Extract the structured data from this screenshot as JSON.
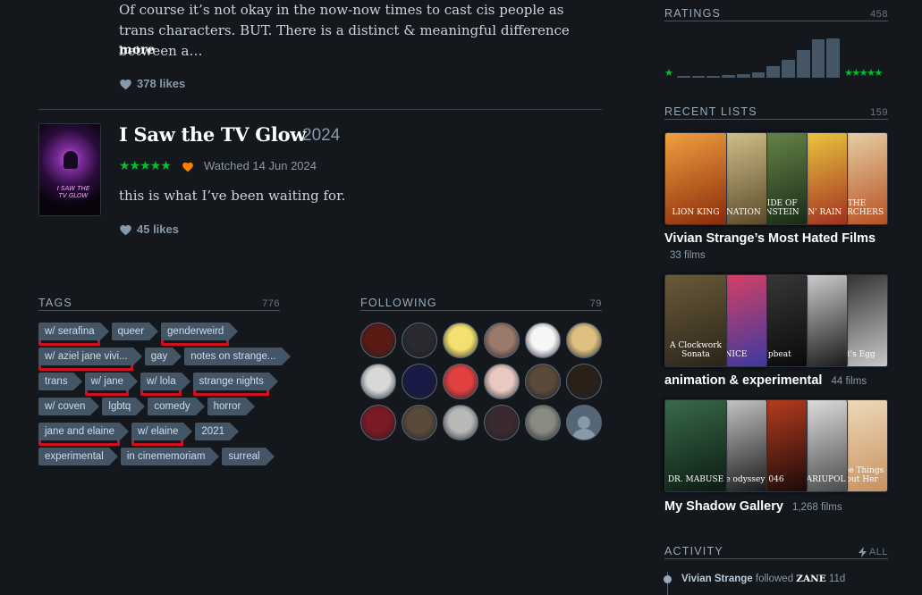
{
  "prev_review": {
    "body": "Of course it’s not okay in the now-now times to cast cis people as trans characters. BUT. There is a distinct & meaningful difference between a…",
    "more": "more",
    "likes": "378 likes"
  },
  "entry": {
    "poster_text": "I SAW THE TV GLOW",
    "title": "I Saw the TV Glow",
    "year": "2024",
    "stars": "★★★★★",
    "watched": "Watched 14 Jun 2024",
    "review": "this is what I’ve been waiting for.",
    "likes": "45 likes"
  },
  "tags": {
    "heading": "TAGS",
    "count": "776",
    "items": [
      {
        "label": "w/ serafina",
        "highlighted": true
      },
      {
        "label": "queer",
        "highlighted": false
      },
      {
        "label": "genderweird",
        "highlighted": true
      },
      {
        "label": "w/ aziel jane vivi...",
        "highlighted": true
      },
      {
        "label": "gay",
        "highlighted": false
      },
      {
        "label": "notes on strange...",
        "highlighted": false
      },
      {
        "label": "trans",
        "highlighted": false
      },
      {
        "label": "w/ jane",
        "highlighted": true
      },
      {
        "label": "w/ lola",
        "highlighted": true
      },
      {
        "label": "strange nights",
        "highlighted": true
      },
      {
        "label": "w/ coven",
        "highlighted": false
      },
      {
        "label": "lgbtq",
        "highlighted": false
      },
      {
        "label": "comedy",
        "highlighted": false
      },
      {
        "label": "horror",
        "highlighted": false
      },
      {
        "label": "jane and elaine",
        "highlighted": true
      },
      {
        "label": "w/ elaine",
        "highlighted": true
      },
      {
        "label": "2021",
        "highlighted": false
      },
      {
        "label": "experimental",
        "highlighted": false
      },
      {
        "label": "in cinememoriam",
        "highlighted": false
      },
      {
        "label": "surreal",
        "highlighted": false
      }
    ]
  },
  "following": {
    "heading": "FOLLOWING",
    "count": "79",
    "avatars": [
      "#5a1a14",
      "#2a2a30",
      "#f4e070",
      "#9a7a6a",
      "#f6f6f6",
      "#e0c080",
      "#d8d8d8",
      "#1a1a48",
      "#e04040",
      "#e8c8c0",
      "#5a4a3a",
      "#2a2018",
      "#7a1a24",
      "#5a4a3a",
      "#b8b8b8",
      "#3a2a30",
      "#8a8a80",
      "#556677"
    ],
    "placeholder_icon": "person-icon"
  },
  "ratings": {
    "heading": "RATINGS",
    "count": "458",
    "star_left": "★",
    "star_right": "★★★★★",
    "distribution": [
      0.02,
      0.04,
      0.04,
      0.06,
      0.07,
      0.1,
      0.22,
      0.35,
      0.55,
      0.75,
      0.78
    ]
  },
  "recent_lists": {
    "heading": "RECENT LISTS",
    "count": "159",
    "lists": [
      {
        "name": "Vivian Strange’s Most Hated Films",
        "count": "33 films",
        "posters": [
          {
            "text": "LION KING",
            "c1": "#f0a040",
            "c2": "#8a2a0a"
          },
          {
            "text": "TH NATION",
            "c1": "#d8c890",
            "c2": "#5a4a2a"
          },
          {
            "text": "BRIDE OF KENSTEIN",
            "c1": "#6a8a4a",
            "c2": "#1a2a18"
          },
          {
            "text": "NGIN' RAIN",
            "c1": "#f0d040",
            "c2": "#a03020"
          },
          {
            "text": "THE SEARCHERS",
            "c1": "#e8d8b0",
            "c2": "#b85020"
          }
        ]
      },
      {
        "name": "animation & experimental",
        "count": "44 films",
        "posters": [
          {
            "text": "A Clockwork Sonata",
            "c1": "#6a5a3a",
            "c2": "#2a2418"
          },
          {
            "text": "NICE",
            "c1": "#e04060",
            "c2": "#3a3aa0"
          },
          {
            "text": "Upbeat",
            "c1": "#3a3a3a",
            "c2": "#0a0a0a"
          },
          {
            "text": "",
            "c1": "#d8d8d8",
            "c2": "#1a1a1a"
          },
          {
            "text": "rot's Egg",
            "c1": "#2a2a2a",
            "c2": "#c8c8c8"
          }
        ]
      },
      {
        "name": "My Shadow Gallery",
        "count": "1,268 films",
        "posters": [
          {
            "text": "DR. MABUSE",
            "c1": "#3a6a4a",
            "c2": "#0a1a10"
          },
          {
            "text": "space odyssey",
            "c1": "#d0d0d0",
            "c2": "#1a1a1a"
          },
          {
            "text": "046",
            "c1": "#c04020",
            "c2": "#1a0a08"
          },
          {
            "text": "AYS ARIUPOL",
            "c1": "#e8e8e8",
            "c2": "#4a4a4a"
          },
          {
            "text": "Three Things About Her",
            "c1": "#f0e0c0",
            "c2": "#c89060"
          }
        ]
      }
    ]
  },
  "activity": {
    "heading": "ACTIVITY",
    "all_label": "ALL",
    "user": "Vivian Strange",
    "action": "followed",
    "target": "ZANE",
    "time": "11d"
  },
  "colors": {
    "accent_green": "#00c030",
    "like_orange": "#ff8000",
    "highlight_red": "#d0101e"
  }
}
